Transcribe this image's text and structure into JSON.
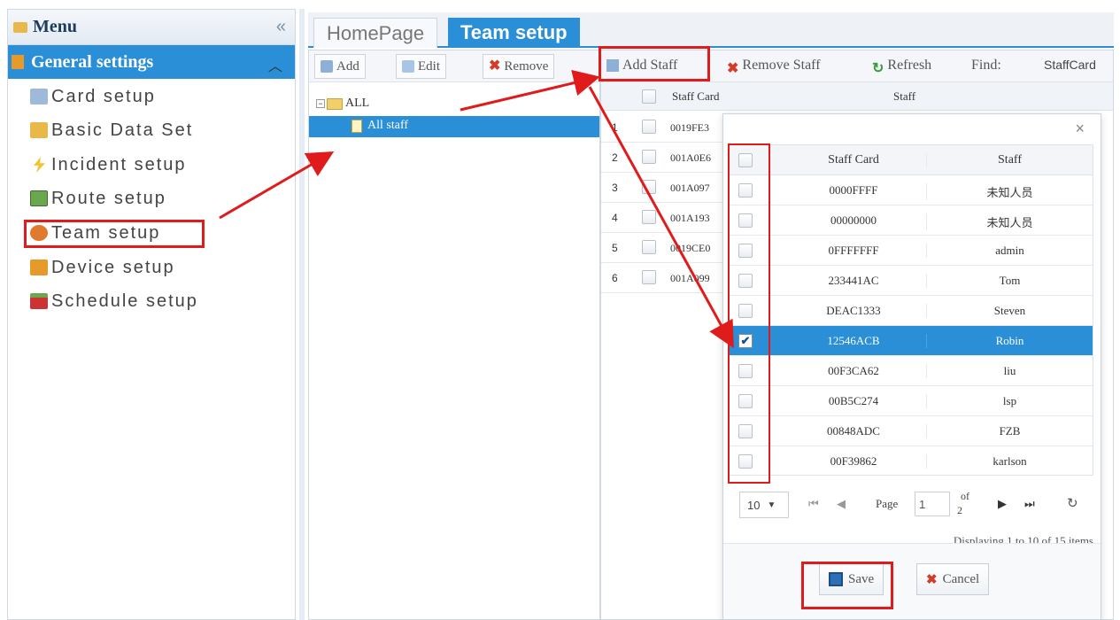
{
  "menu": {
    "title": "Menu",
    "collapse_glyph": "«",
    "section": "General settings",
    "items": [
      {
        "label": "Card setup",
        "icon": "card-icon",
        "color": "#9fb9d9"
      },
      {
        "label": "Basic Data Set",
        "icon": "data-icon",
        "color": "#e8b94a"
      },
      {
        "label": "Incident setup",
        "icon": "lightning-icon",
        "color": "#f1c232"
      },
      {
        "label": "Route setup",
        "icon": "map-icon",
        "color": "#6aa84f"
      },
      {
        "label": "Team setup",
        "icon": "team-icon",
        "color": "#e07a2e"
      },
      {
        "label": "Device setup",
        "icon": "device-icon",
        "color": "#e59a2a"
      },
      {
        "label": "Schedule setup",
        "icon": "calendar-icon",
        "color": "#cc3333"
      }
    ]
  },
  "tabs": {
    "home": "HomePage",
    "team": "Team setup"
  },
  "team_toolbar": {
    "add": "Add",
    "edit": "Edit",
    "remove": "Remove"
  },
  "tree": {
    "root": "ALL",
    "child": "All staff"
  },
  "staff_toolbar": {
    "add_staff": "Add Staff",
    "remove_staff": "Remove Staff",
    "refresh": "Refresh",
    "find": "Find:",
    "find_value": "StaffCard"
  },
  "staff_grid": {
    "headers": {
      "card": "Staff Card",
      "staff": "Staff"
    },
    "rows": [
      {
        "num": "1",
        "card": "0019FE3"
      },
      {
        "num": "2",
        "card": "001A0E6"
      },
      {
        "num": "3",
        "card": "001A097"
      },
      {
        "num": "4",
        "card": "001A193"
      },
      {
        "num": "5",
        "card": "0019CE0"
      },
      {
        "num": "6",
        "card": "001A099"
      }
    ]
  },
  "dialog": {
    "close": "×",
    "headers": {
      "card": "Staff Card",
      "staff": "Staff"
    },
    "rows": [
      {
        "card": "0000FFFF",
        "staff": "未知人员",
        "checked": false
      },
      {
        "card": "00000000",
        "staff": "未知人员",
        "checked": false
      },
      {
        "card": "0FFFFFFF",
        "staff": "admin",
        "checked": false
      },
      {
        "card": "233441AC",
        "staff": "Tom",
        "checked": false
      },
      {
        "card": "DEAC1333",
        "staff": "Steven",
        "checked": false
      },
      {
        "card": "12546ACB",
        "staff": "Robin",
        "checked": true
      },
      {
        "card": "00F3CA62",
        "staff": "liu",
        "checked": false
      },
      {
        "card": "00B5C274",
        "staff": "lsp",
        "checked": false
      },
      {
        "card": "00848ADC",
        "staff": "FZB",
        "checked": false
      },
      {
        "card": "00F39862",
        "staff": "karlson",
        "checked": false
      }
    ],
    "pager": {
      "page_size": "10",
      "page_label": "Page",
      "page_value": "1",
      "of_label": "of",
      "total_pages": "2",
      "display_text": "Displaying 1 to 10 of 15 items"
    },
    "save": "Save",
    "cancel": "Cancel"
  },
  "colors": {
    "accent": "#2a8fd6",
    "annotation": "#e01b1b"
  }
}
